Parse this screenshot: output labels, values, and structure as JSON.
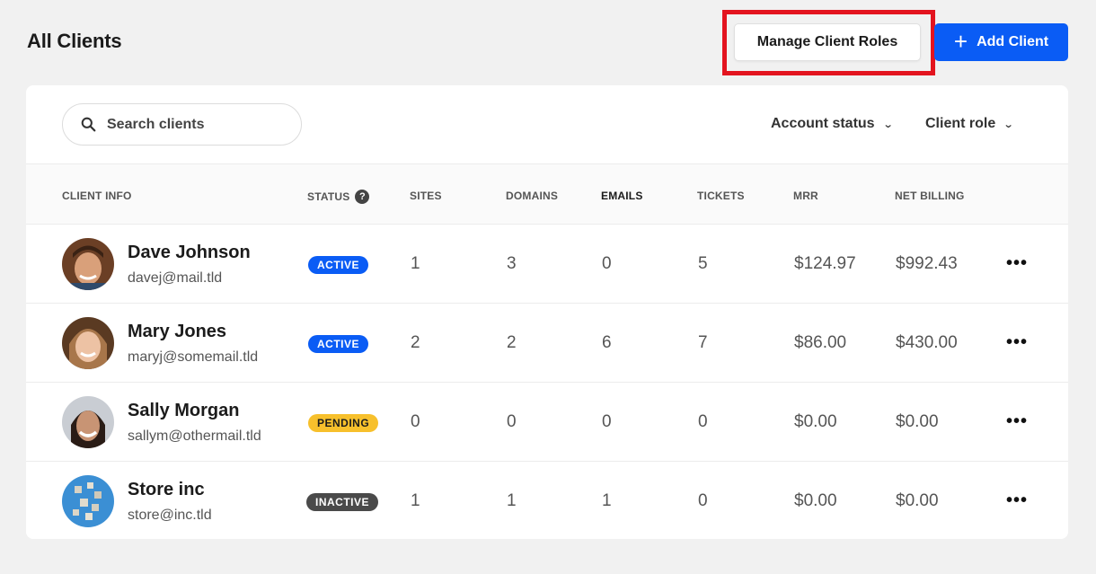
{
  "header": {
    "title": "All Clients",
    "manage_roles_label": "Manage Client Roles",
    "add_client_label": "Add Client",
    "add_icon": "plus-icon",
    "accent": "#0a5cf5",
    "highlight_color": "#e3141f"
  },
  "toolbar": {
    "search_placeholder": "Search clients",
    "search_icon": "search-icon",
    "filters": [
      {
        "label": "Account status",
        "icon": "chevron-down-icon"
      },
      {
        "label": "Client role",
        "icon": "chevron-down-icon"
      }
    ]
  },
  "table": {
    "columns": [
      "CLIENT INFO",
      "STATUS",
      "SITES",
      "DOMAINS",
      "EMAILS",
      "TICKETS",
      "MRR",
      "NET BILLING"
    ],
    "status_help_icon": "question-circle-icon",
    "rows": [
      {
        "name": "Dave Johnson",
        "email": "davej@mail.tld",
        "status": "ACTIVE",
        "sites": "1",
        "domains": "3",
        "emails": "0",
        "tickets": "5",
        "mrr": "$124.97",
        "net_billing": "$992.43",
        "more": "•••"
      },
      {
        "name": "Mary Jones",
        "email": "maryj@somemail.tld",
        "status": "ACTIVE",
        "sites": "2",
        "domains": "2",
        "emails": "6",
        "tickets": "7",
        "mrr": "$86.00",
        "net_billing": "$430.00",
        "more": "•••"
      },
      {
        "name": "Sally Morgan",
        "email": "sallym@othermail.tld",
        "status": "PENDING",
        "sites": "0",
        "domains": "0",
        "emails": "0",
        "tickets": "0",
        "mrr": "$0.00",
        "net_billing": "$0.00",
        "more": "•••"
      },
      {
        "name": "Store inc",
        "email": "store@inc.tld",
        "status": "INACTIVE",
        "sites": "1",
        "domains": "1",
        "emails": "1",
        "tickets": "0",
        "mrr": "$0.00",
        "net_billing": "$0.00",
        "more": "•••"
      }
    ]
  },
  "status_colors": {
    "ACTIVE": "#0a5cf5",
    "PENDING": "#f7c02c",
    "INACTIVE": "#4a4a4a"
  }
}
